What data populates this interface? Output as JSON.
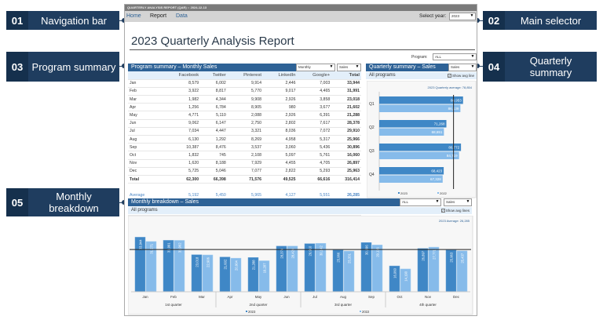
{
  "callouts": [
    {
      "num": "01",
      "label": "Navigation bar"
    },
    {
      "num": "02",
      "label": "Main selector"
    },
    {
      "num": "03",
      "label": "Program summary"
    },
    {
      "num": "04",
      "label": "Quarterly summary"
    },
    {
      "num": "05",
      "label": "Monthly breakdown"
    }
  ],
  "window_title": "QUARTERLY ANALYSIS REPORT (QAR) :: 2024-12-13",
  "nav": {
    "items": [
      "Home",
      "Report",
      "Data"
    ],
    "select_year_label": "Select year:",
    "year": "2023"
  },
  "page_title": "2023 Quarterly Analysis Report",
  "program_filter": {
    "label": "Program:",
    "value": "ALL"
  },
  "program_summary": {
    "title": "Program summary – Monthly Sales",
    "period": "Monthly",
    "measure": "Sales",
    "columns": [
      "",
      "Facebook",
      "Twitter",
      "Pinterest",
      "LinkedIn",
      "Google+",
      "Total"
    ],
    "rows": [
      [
        "Jan",
        "8,579",
        "6,002",
        "9,914",
        "2,446",
        "7,003",
        "33,944"
      ],
      [
        "Feb",
        "3,922",
        "8,817",
        "5,770",
        "9,017",
        "4,465",
        "31,991"
      ],
      [
        "Mar",
        "1,982",
        "4,344",
        "9,908",
        "2,926",
        "3,858",
        "23,018"
      ],
      [
        "Apr",
        "1,256",
        "6,784",
        "8,905",
        "980",
        "3,677",
        "21,602"
      ],
      [
        "May",
        "4,771",
        "5,110",
        "2,088",
        "2,926",
        "6,391",
        "21,288"
      ],
      [
        "Jun",
        "9,062",
        "6,147",
        "2,750",
        "2,802",
        "7,617",
        "28,378"
      ],
      [
        "Jul",
        "7,034",
        "4,447",
        "3,321",
        "8,036",
        "7,072",
        "29,910"
      ],
      [
        "Aug",
        "6,130",
        "1,292",
        "8,269",
        "4,958",
        "5,317",
        "25,966"
      ],
      [
        "Sep",
        "10,387",
        "8,476",
        "3,537",
        "3,060",
        "5,436",
        "30,896"
      ],
      [
        "Oct",
        "1,832",
        "745",
        "2,108",
        "5,097",
        "5,761",
        "16,060"
      ],
      [
        "Nov",
        "1,620",
        "8,188",
        "7,929",
        "4,455",
        "4,705",
        "26,897"
      ],
      [
        "Dec",
        "5,725",
        "5,046",
        "7,077",
        "2,822",
        "5,293",
        "25,963"
      ]
    ],
    "total": [
      "Total",
      "62,300",
      "66,398",
      "71,576",
      "49,525",
      "66,616",
      "316,414"
    ],
    "stats": [
      [
        "Average",
        "5,192",
        "5,450",
        "5,965",
        "4,127",
        "5,551",
        "26,285"
      ],
      [
        "High",
        "10,387",
        "8,817",
        "9,914",
        "9,017",
        "7,617",
        "33,944"
      ],
      [
        "Low",
        "1,256",
        "745",
        "2,088",
        "980",
        "3,677",
        "16,060"
      ]
    ]
  },
  "quarterly_summary": {
    "title": "Quarterly summary – Sales",
    "measure": "Sales",
    "subtitle": "All programs",
    "show_avg_label": "Show avg line",
    "show_avg": true,
    "avg_label": "2023 Quarterly average: 78,854"
  },
  "monthly_breakdown": {
    "title": "Monthly breakdown – Sales",
    "filter": "ALL",
    "measure": "Sales",
    "subtitle": "All programs",
    "show_avg_label": "Show avg lines",
    "show_avg": true,
    "avg_label": "2023 Average: 26,285"
  },
  "colors": {
    "series_2023": "#3f87c6",
    "series_2022": "#86bbea",
    "header": "#2e6296",
    "callout": "#1f3d5f"
  },
  "chart_data": [
    {
      "type": "bar",
      "orientation": "horizontal",
      "categories": [
        "Q1",
        "Q2",
        "Q3",
        "Q4"
      ],
      "series": [
        {
          "name": "2023",
          "values": [
            88953,
            71268,
            86772,
            68423
          ],
          "labels": [
            "88,953",
            "71,268",
            "86,772",
            "68,423"
          ]
        },
        {
          "name": "2022",
          "values": [
            86139,
            68651,
            84719,
            67328
          ],
          "labels": [
            "86,139",
            "68,651",
            "84,719",
            "67,328"
          ]
        }
      ],
      "average": 78854,
      "legend": "bottom",
      "xlim": [
        0,
        100000
      ]
    },
    {
      "type": "bar",
      "categories": [
        "Jan",
        "Feb",
        "Mar",
        "Apr",
        "May",
        "Jun",
        "Jul",
        "Aug",
        "Sep",
        "Oct",
        "Nov",
        "Dec"
      ],
      "groups": [
        "1st quarter",
        "2nd quarter",
        "3rd quarter",
        "4th quarter"
      ],
      "series": [
        {
          "name": "2023",
          "values": [
            33944,
            31991,
            23018,
            21602,
            21288,
            28378,
            29910,
            25966,
            30596,
            16060,
            26897,
            25963
          ],
          "labels": [
            "33,944",
            "31,991",
            "23,018",
            "21,602",
            "21,288",
            "28,378",
            "29,910",
            "25,966",
            "30,596",
            "16,060",
            "26,897",
            "25,963"
          ]
        },
        {
          "name": "2022",
          "values": [
            31271,
            31962,
            22906,
            20904,
            19287,
            28420,
            30142,
            25331,
            29116,
            14190,
            27771,
            25437
          ],
          "labels": [
            "31,271",
            "31,962",
            "22,906",
            "20,904",
            "19,287",
            "28,420",
            "30,142",
            "25,331",
            "29,116",
            "14,190",
            "27,771",
            "25,437"
          ]
        }
      ],
      "average": 26285,
      "legend": "bottom",
      "ylim": [
        0,
        45000
      ]
    }
  ]
}
